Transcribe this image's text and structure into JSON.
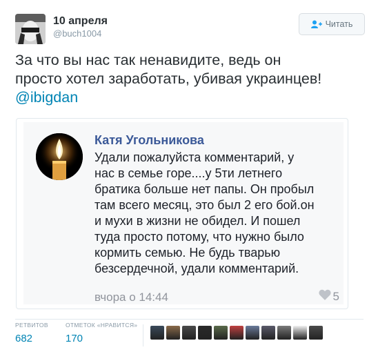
{
  "author": {
    "name": "10 апреля",
    "handle": "@buch1004",
    "avatar_icon": "author-avatar"
  },
  "follow_button": {
    "label": "Читать",
    "icon": "person-plus-icon"
  },
  "tweet": {
    "lines": [
      "За что вы нас так ненавидите, ведь он",
      "просто хотел заработать, убивая украинцев!"
    ],
    "mention": "@ibigdan"
  },
  "attached_screenshot": {
    "name": "Катя Угольникова",
    "avatar_icon": "candle-avatar",
    "text_lines": [
      "Удали пожалуйста комментарий, у",
      "нас в семье горе....у 5ти летнего",
      "братика больше нет папы. Он пробыл",
      "там всего месяц, это был 2 его бой.он",
      "и мухи в жизни не обидел. И пошел",
      "туда просто потому, что нужно было",
      "кормить семью. Не будь тварью",
      "безсердечной, удали комментарий."
    ],
    "time": "вчора о 14:44",
    "likes": "5"
  },
  "stats": {
    "retweets_label": "РЕТВИТОВ",
    "retweets_value": "682",
    "likes_label": "ОТМЕТОК «НРАВИТСЯ»",
    "likes_value": "170"
  },
  "likers": [
    {
      "icon": "liker-avatar-1",
      "color": "#3a4a5a"
    },
    {
      "icon": "liker-avatar-2",
      "color": "#8a6a4a"
    },
    {
      "icon": "liker-avatar-3",
      "color": "#4a4a4a"
    },
    {
      "icon": "liker-avatar-4",
      "color": "#2a2a2a"
    },
    {
      "icon": "liker-avatar-5",
      "color": "#5a6a4a"
    },
    {
      "icon": "liker-avatar-6",
      "color": "#c04040"
    },
    {
      "icon": "liker-avatar-7",
      "color": "#6a7a9a"
    },
    {
      "icon": "liker-avatar-8",
      "color": "#5a5a6a"
    },
    {
      "icon": "liker-avatar-9",
      "color": "#7a7a7a"
    },
    {
      "icon": "liker-avatar-10",
      "color": "#f0f0f0"
    },
    {
      "icon": "liker-avatar-11",
      "color": "#4a4a4a"
    }
  ],
  "colors": {
    "link": "#0084b4",
    "facebook_name": "#3b5998",
    "muted": "#8899a6"
  }
}
